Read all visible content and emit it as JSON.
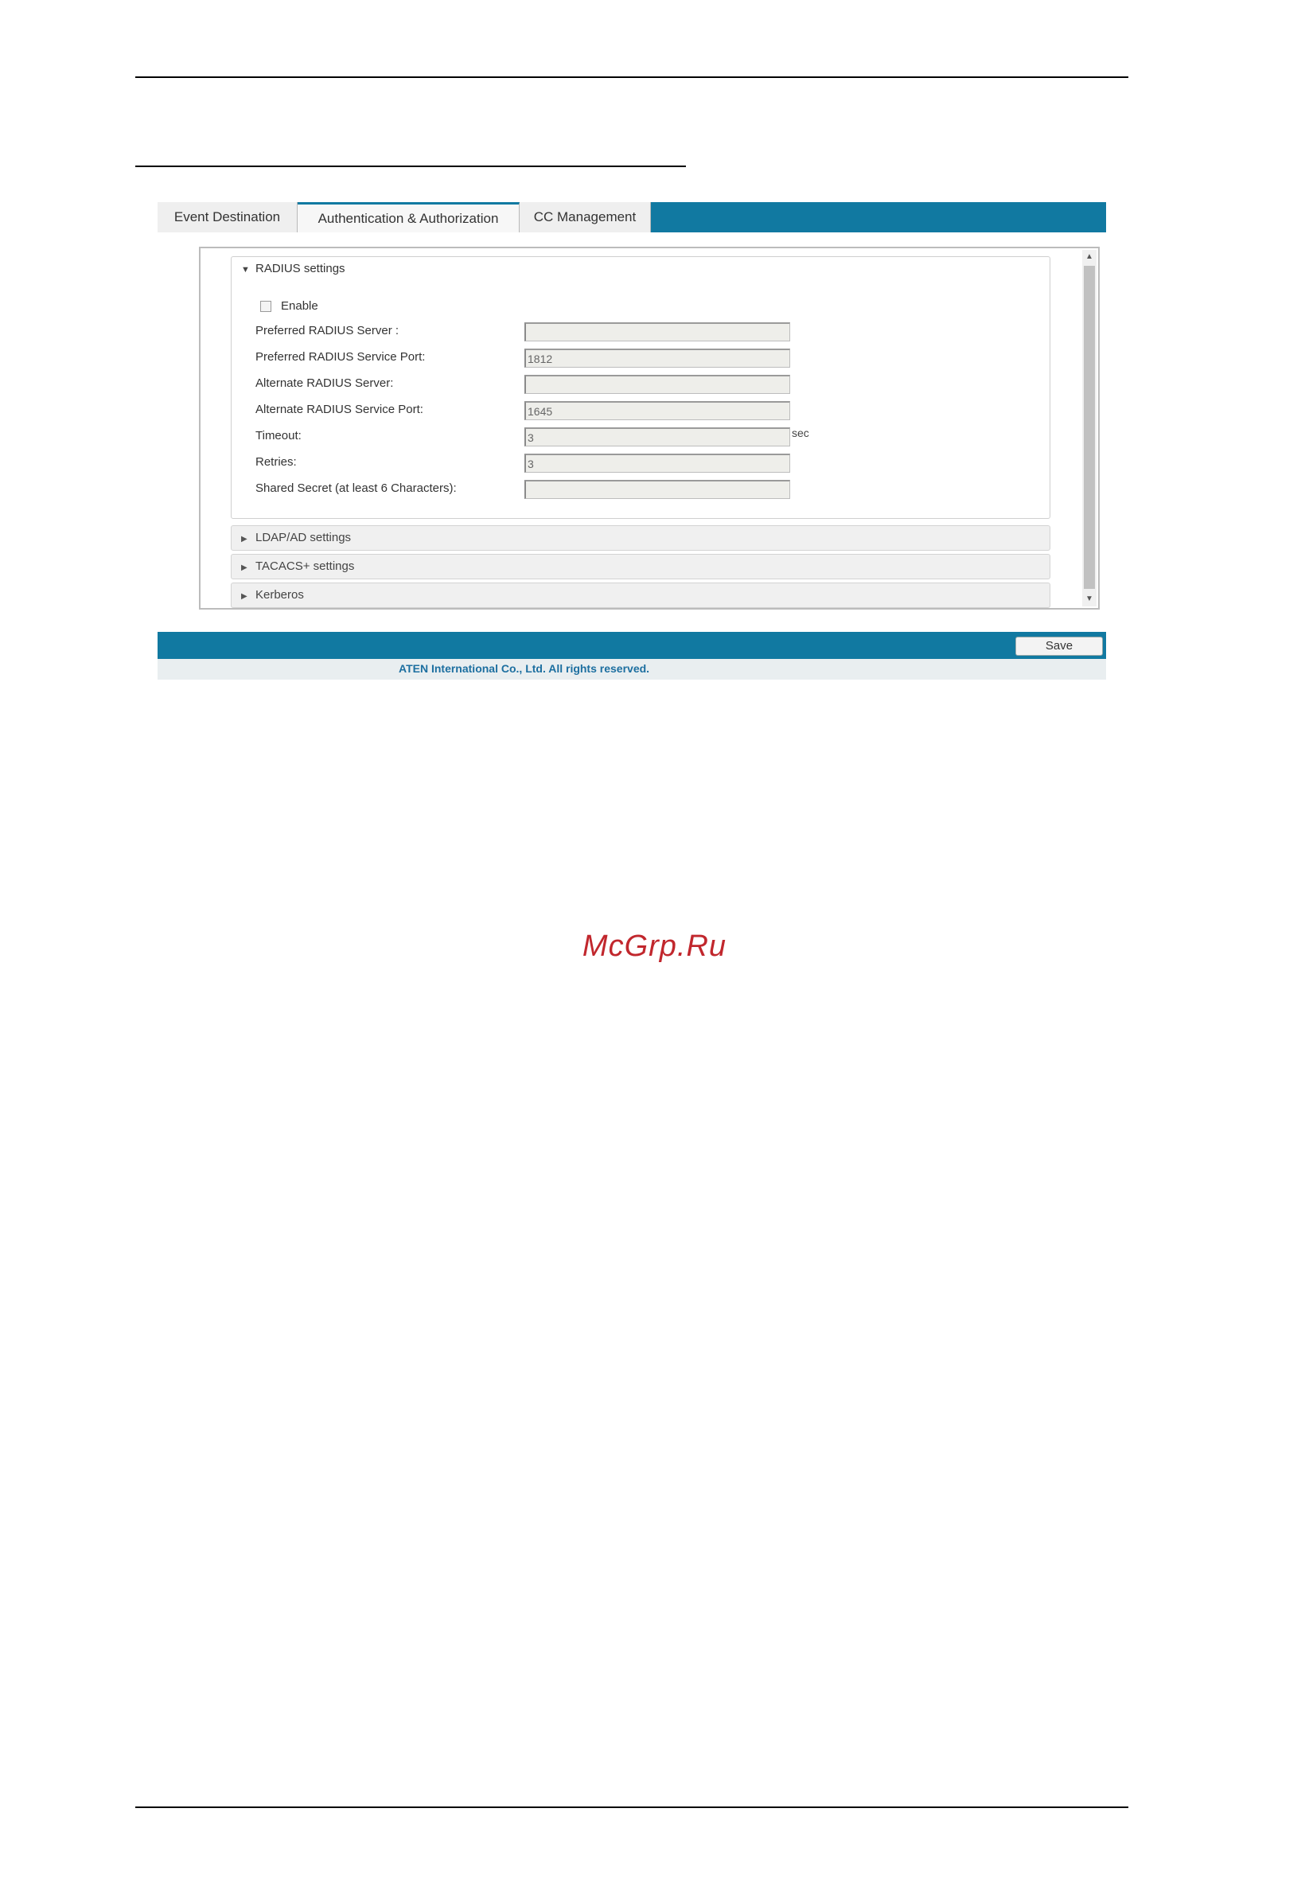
{
  "tabs": [
    "Event Destination",
    "Authentication & Authorization",
    "CC Management"
  ],
  "radius": {
    "title": "RADIUS settings",
    "enable_label": "Enable",
    "fields": [
      {
        "label": "Preferred RADIUS Server :",
        "value": ""
      },
      {
        "label": "Preferred RADIUS Service Port:",
        "value": "1812"
      },
      {
        "label": "Alternate RADIUS Server:",
        "value": ""
      },
      {
        "label": "Alternate RADIUS Service Port:",
        "value": "1645"
      },
      {
        "label": "Timeout:",
        "value": "3",
        "unit": "sec"
      },
      {
        "label": "Retries:",
        "value": "3"
      },
      {
        "label": "Shared Secret (at least 6 Characters):",
        "value": ""
      }
    ]
  },
  "collapsed_sections": [
    "LDAP/AD settings",
    "TACACS+ settings",
    "Kerberos"
  ],
  "save_label": "Save",
  "footer": "ATEN International Co., Ltd. All rights reserved.",
  "watermark": "McGrp.Ru"
}
